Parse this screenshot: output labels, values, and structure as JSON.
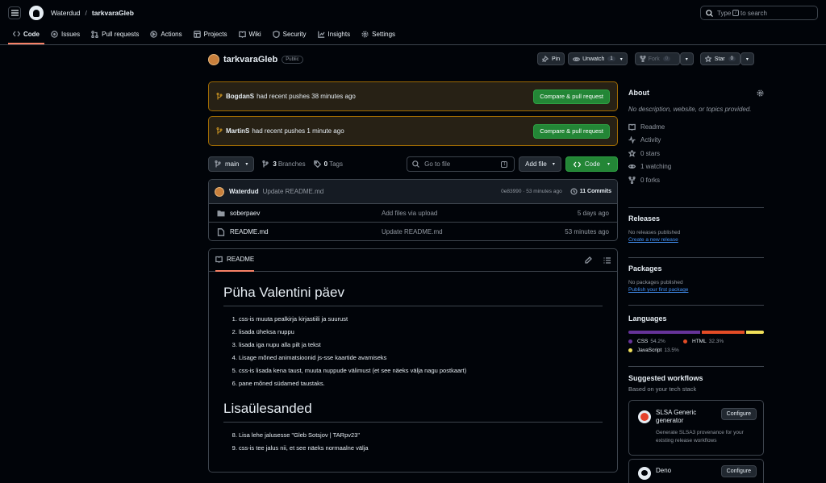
{
  "header": {
    "owner": "Waterdud",
    "repo": "tarkvaraGleb",
    "search_prefix": "Type",
    "search_key": "/",
    "search_suffix": "to search"
  },
  "nav": [
    {
      "label": "Code",
      "icon": "code-icon"
    },
    {
      "label": "Issues",
      "icon": "issue-icon"
    },
    {
      "label": "Pull requests",
      "icon": "pull-request-icon"
    },
    {
      "label": "Actions",
      "icon": "play-icon"
    },
    {
      "label": "Projects",
      "icon": "table-icon"
    },
    {
      "label": "Wiki",
      "icon": "book-icon"
    },
    {
      "label": "Security",
      "icon": "shield-icon"
    },
    {
      "label": "Insights",
      "icon": "graph-icon"
    },
    {
      "label": "Settings",
      "icon": "gear-icon"
    }
  ],
  "repo": {
    "name": "tarkvaraGleb",
    "visibility": "Public"
  },
  "actions": {
    "pin": "Pin",
    "unwatch": "Unwatch",
    "watch_count": "1",
    "fork": "Fork",
    "fork_count": "0",
    "star": "Star",
    "star_count": "0"
  },
  "banners": [
    {
      "user": "BogdanS",
      "text": "had recent pushes 38 minutes ago",
      "button": "Compare & pull request"
    },
    {
      "user": "MartinS",
      "text": "had recent pushes 1 minute ago",
      "button": "Compare & pull request"
    }
  ],
  "bar": {
    "branch": "main",
    "branches_count": "3",
    "branches_label": "Branches",
    "tags_count": "0",
    "tags_label": "Tags",
    "go_to_file": "Go to file",
    "go_key": "t",
    "add_file": "Add file",
    "code": "Code"
  },
  "commit": {
    "author": "Waterdud",
    "message": "Update README.md",
    "hash_time": "0e83990 · 53 minutes ago",
    "commits": "11 Commits"
  },
  "files": [
    {
      "name": "soberpaev",
      "type": "folder",
      "message": "Add files via upload",
      "date": "5 days ago"
    },
    {
      "name": "README.md",
      "type": "file",
      "message": "Update README.md",
      "date": "53 minutes ago"
    }
  ],
  "readme": {
    "tab": "README",
    "h1": "Püha Valentini päev",
    "items1": [
      "css-is muuta pealkirja kirjastiili ja suurust",
      "lisada üheksa nuppu",
      "lisada iga nupu alla pilt ja tekst",
      "Lisage mõned animatsioonid js-sse kaartide avamiseks",
      "css-is lisada kena taust, muuta nuppude välimust (et see näeks välja nagu postkaart)",
      "pane mõned südamed taustaks."
    ],
    "h2": "Lisaülesanded",
    "items2": [
      "Lisa lehe jalusesse \"Gleb Sotsjov | TARpv23\"",
      "css-is tee jalus nii, et see näeks normaalne välja"
    ]
  },
  "about": {
    "title": "About",
    "desc": "No description, website, or topics provided.",
    "stats": [
      {
        "label": "Readme",
        "icon": "book-icon"
      },
      {
        "label": "Activity",
        "icon": "pulse-icon"
      },
      {
        "label": "0 stars",
        "icon": "star-icon"
      },
      {
        "label": "1 watching",
        "icon": "eye-icon"
      },
      {
        "label": "0 forks",
        "icon": "fork-icon"
      }
    ]
  },
  "releases": {
    "title": "Releases",
    "none": "No releases published",
    "link": "Create a new release"
  },
  "packages": {
    "title": "Packages",
    "none": "No packages published",
    "link": "Publish your first package"
  },
  "languages": {
    "title": "Languages",
    "items": [
      {
        "name": "CSS",
        "pct": "54.2%",
        "value": 54.2,
        "color": "#663399"
      },
      {
        "name": "HTML",
        "pct": "32.3%",
        "value": 32.3,
        "color": "#e34c26"
      },
      {
        "name": "JavaScript",
        "pct": "13.5%",
        "value": 13.5,
        "color": "#f1e05a"
      }
    ]
  },
  "workflows": {
    "title": "Suggested workflows",
    "subtitle": "Based on your tech stack",
    "items": [
      {
        "name": "SLSA Generic generator",
        "desc": "Generate SLSA3 provenance for your existing release workflows",
        "button": "Configure"
      },
      {
        "name": "Deno",
        "button": "Configure"
      }
    ]
  }
}
